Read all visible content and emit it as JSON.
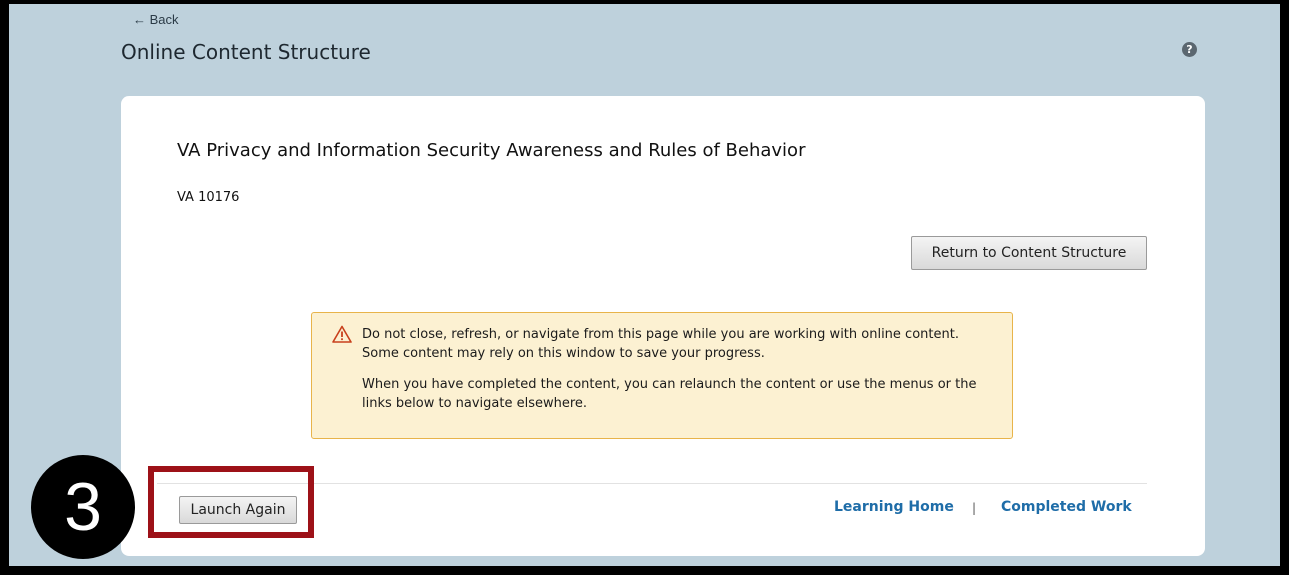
{
  "header": {
    "back_label": "← Back",
    "page_title": "Online Content Structure",
    "help_icon": "question-circle-icon",
    "help_glyph": "?"
  },
  "course": {
    "title": "VA Privacy and Information Security Awareness and Rules of Behavior",
    "code": "VA 10176"
  },
  "buttons": {
    "return_label": "Return to Content Structure",
    "launch_label": "Launch Again"
  },
  "alert": {
    "icon": "warning-triangle-icon",
    "line1": "Do not close, refresh, or navigate from this page while you are working with online content. Some content may rely on this window to save your progress.",
    "line2": "When you have completed the content, you can relaunch the content or use the menus or the links below to navigate elsewhere."
  },
  "footer": {
    "learning_home": "Learning Home",
    "separator": "|",
    "completed_work": "Completed Work"
  },
  "annotation": {
    "step_number": "3",
    "highlight_color": "#9d1118"
  },
  "colors": {
    "background": "#bed1dc",
    "link": "#1f6da8",
    "alert_bg": "#fcf1d2",
    "alert_border": "#e8b44a"
  }
}
